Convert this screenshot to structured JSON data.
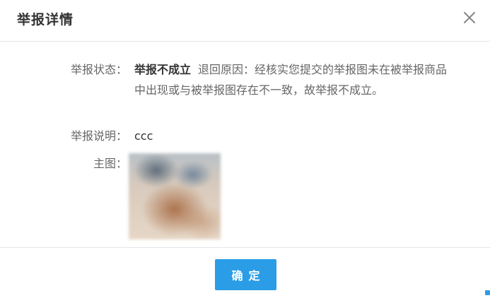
{
  "dialog": {
    "title": "举报详情",
    "close_icon": "close-icon"
  },
  "details": {
    "status_label": "举报状态：",
    "status_value": "举报不成立",
    "reason_label": "退回原因：",
    "reason_text": "经核实您提交的举报图未在被举报商品中出现或与被举报图存在不一致，故举报不成立。",
    "desc_label": "举报说明：",
    "desc_value": "ccc",
    "image_label": "主图："
  },
  "footer": {
    "confirm_label": "确定"
  },
  "colors": {
    "accent": "#2b9de6",
    "text": "#333333",
    "label": "#666666",
    "divider": "#e6e6e6"
  }
}
